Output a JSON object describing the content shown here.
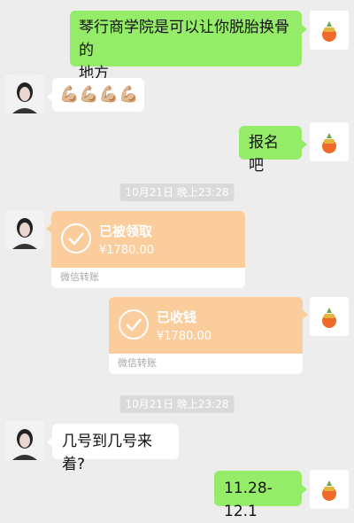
{
  "messages": {
    "m1": {
      "text_line1": "琴行商学院是可以让你脱胎换骨的",
      "text_line2": "地方"
    },
    "m2": {
      "emoji": "💪🏼💪🏼💪🏼💪🏼"
    },
    "m3": {
      "text": "报名吧"
    },
    "ts1": {
      "text": "10月21日 晚上23:28"
    },
    "t1": {
      "status": "已被领取",
      "amount": "¥1780.00",
      "footer": "微信转账"
    },
    "t2": {
      "status": "已收钱",
      "amount": "¥1780.00",
      "footer": "微信转账"
    },
    "ts2": {
      "text": "10月21日 晚上23:28"
    },
    "m4": {
      "text": "几号到几号来着?"
    },
    "m5": {
      "text": "11.28-12.1"
    }
  },
  "colors": {
    "background": "#ededed",
    "outgoing_bubble": "#95ec69",
    "incoming_bubble": "#ffffff",
    "transfer_orange": "#fbcd9d",
    "timestamp_bg": "#dadada"
  }
}
